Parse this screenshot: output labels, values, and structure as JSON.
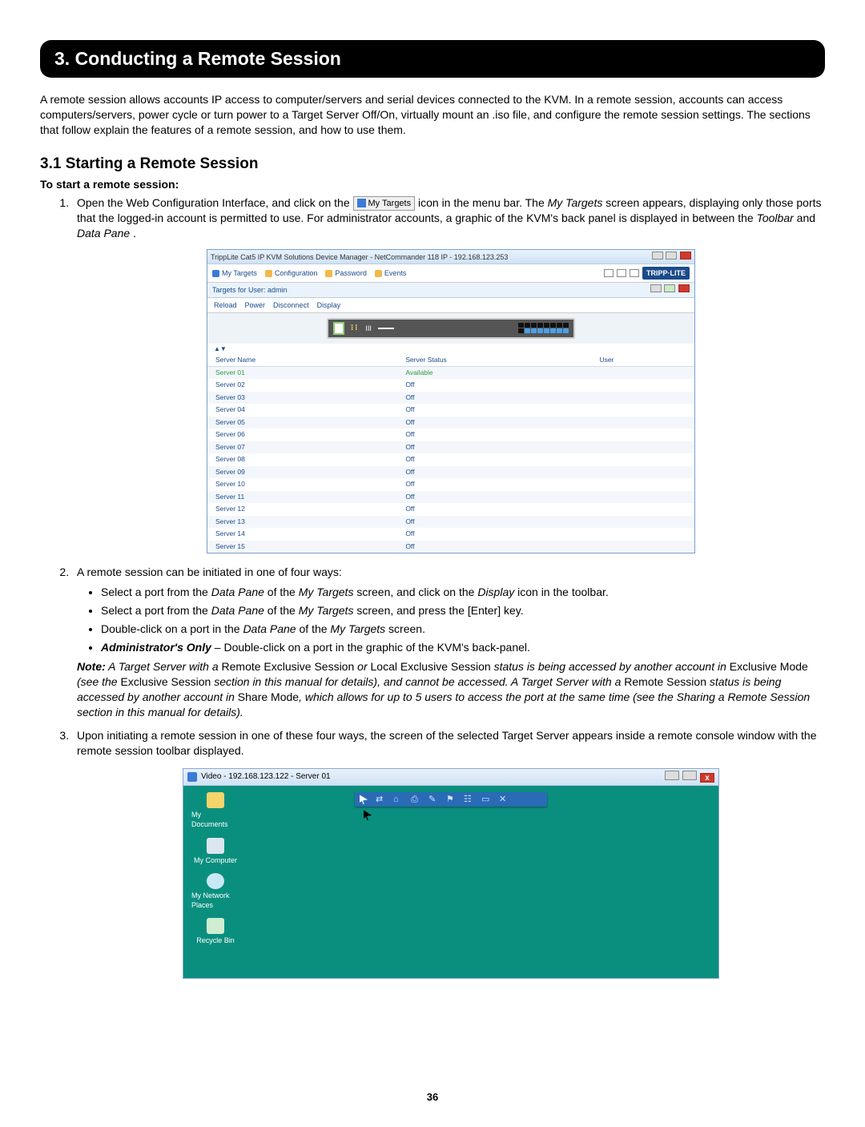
{
  "banner": "3. Conducting a Remote Session",
  "intro": "A remote session allows accounts IP access to computer/servers and serial devices connected to the KVM. In a remote session, accounts can access computers/servers, power cycle or turn power to a Target Server Off/On, virtually mount an .iso file, and configure the remote session settings. The sections that follow explain the features of a remote session, and how to use them.",
  "sec31": "3.1 Starting a Remote Session",
  "to_start": "To start a remote session:",
  "step1a": "Open the Web Configuration Interface, and click on the ",
  "my_targets_chip": "My Targets",
  "step1b": " icon in the menu bar. The ",
  "my_targets_ital": "My Targets",
  "step1c": " screen appears, displaying only those ports that the logged-in account is permitted to use. For administrator accounts, a graphic of the KVM's back panel is displayed in between the ",
  "toolbar_ital": "Toolbar",
  "and_word": " and ",
  "datapane_ital": "Data Pane",
  "period": ".",
  "shot1": {
    "title": "TrippLite Cat5 IP KVM Solutions Device Manager - NetCommander 118 IP - 192.168.123.253",
    "tabs": {
      "t1": "My Targets",
      "t2": "Configuration",
      "t3": "Password",
      "t4": "Events"
    },
    "logo": "TRIPP·LITE",
    "subbar": "Targets for User: admin",
    "tools": {
      "a": "Reload",
      "b": "Power",
      "c": "Disconnect",
      "d": "Display"
    },
    "grp": "⁝⁝",
    "bars": "III",
    "sort": "▲▼",
    "th": {
      "name": "Server Name",
      "status": "Server Status",
      "user": "User"
    },
    "rows": [
      {
        "name": "Server 01",
        "status": "Available",
        "avail": true
      },
      {
        "name": "Server 02",
        "status": "Off"
      },
      {
        "name": "Server 03",
        "status": "Off"
      },
      {
        "name": "Server 04",
        "status": "Off"
      },
      {
        "name": "Server 05",
        "status": "Off"
      },
      {
        "name": "Server 06",
        "status": "Off"
      },
      {
        "name": "Server 07",
        "status": "Off"
      },
      {
        "name": "Server 08",
        "status": "Off"
      },
      {
        "name": "Server 09",
        "status": "Off"
      },
      {
        "name": "Server 10",
        "status": "Off"
      },
      {
        "name": "Server 11",
        "status": "Off"
      },
      {
        "name": "Server 12",
        "status": "Off"
      },
      {
        "name": "Server 13",
        "status": "Off"
      },
      {
        "name": "Server 14",
        "status": "Off"
      },
      {
        "name": "Server 15",
        "status": "Off"
      }
    ]
  },
  "step2": "A remote session can be initiated in one of four ways:",
  "b1a": "Select a port from the ",
  "b1_dp": "Data Pane",
  "b1b": " of the ",
  "b1_mt": "My Targets",
  "b1c": " screen, and click on the ",
  "b1_disp": "Display",
  "b1d": " icon in the toolbar.",
  "b2a": "Select a port from the ",
  "b2b": " of the ",
  "b2c": " screen, and press the [Enter] key.",
  "b3a": "Double-click on a port in the ",
  "b3b": " of the ",
  "b3c": " screen.",
  "b4_admin": "Administrator's Only",
  "b4a": " – Double-click on a port in the graphic of the KVM's back-panel.",
  "note_label": "Note:",
  "note_a": " A Target Server with a ",
  "note_res": "Remote Exclusive Session",
  "note_or": " or ",
  "note_les": "Local Exclusive Session",
  "note_b": " status is being accessed by another account in ",
  "note_em": "Exclusive Mode",
  "note_c": " (see the ",
  "note_exs": "Exclusive Session",
  "note_d": " section in this manual for details), and cannot be accessed. A Target Server with a ",
  "note_rs": "Remote Session",
  "note_e": " status is being accessed by another account in ",
  "note_sm": "Share Mode",
  "note_f": ", which allows for up to 5 users to access the port at the same time (see the Sharing a Remote Session section in this manual for details).",
  "step3": "Upon initiating a remote session in one of these four ways, the screen of the selected Target Server appears inside a remote console window with the remote session toolbar displayed.",
  "shot2": {
    "title": "Video - 192.168.123.122 - Server 01",
    "icons": {
      "doc": "My Documents",
      "comp": "My Computer",
      "net": "My Network Places",
      "bin": "Recycle Bin"
    },
    "tb_x": "✕",
    "tb_sq": "▭"
  },
  "page": "36"
}
